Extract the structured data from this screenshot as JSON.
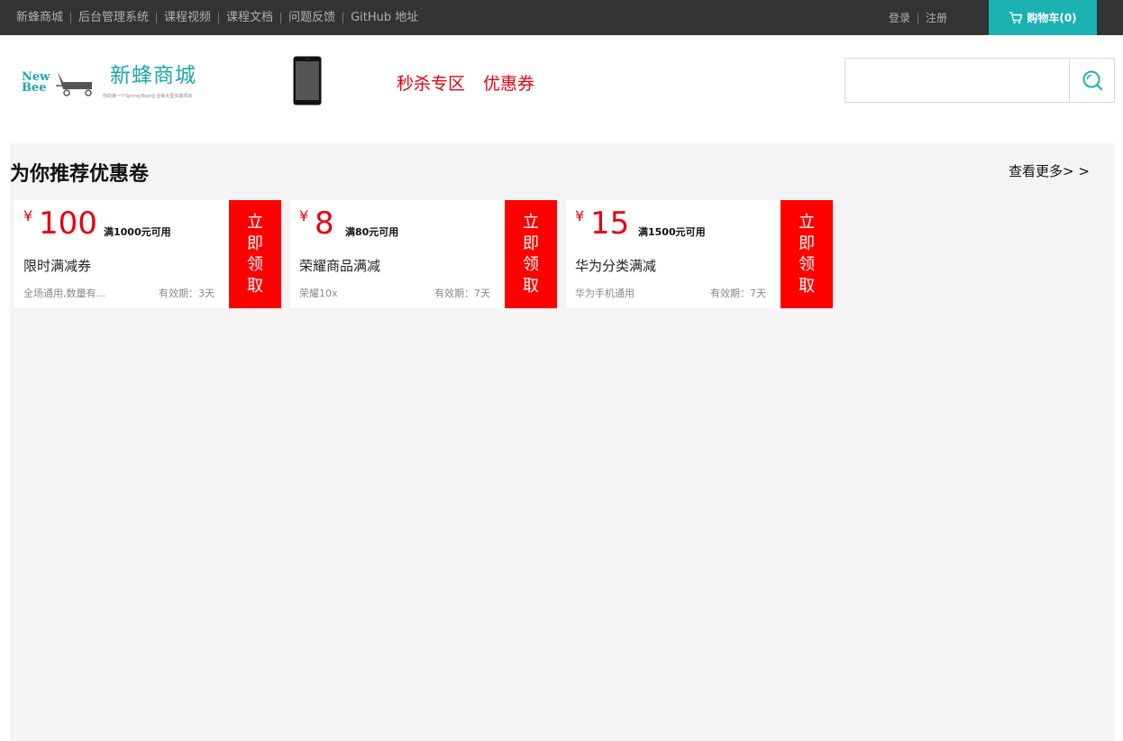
{
  "topnav": {
    "links": [
      "新蜂商城",
      "后台管理系统",
      "课程视频",
      "课程文档",
      "问题反馈",
      "GitHub 地址"
    ]
  },
  "user": {
    "login": "登录",
    "register": "注册"
  },
  "cart": {
    "label": "购物车(0)",
    "icon": "cart-icon"
  },
  "brand": {
    "logo_line1": "New",
    "logo_line2": "Bee",
    "title": "新蜂商城",
    "subtitle": "你的第一个Spring Boot企业级大型实践项目"
  },
  "nav": {
    "seckill": "秒杀专区",
    "coupon": "优惠券"
  },
  "search": {
    "placeholder": "",
    "icon": "search-icon"
  },
  "section": {
    "title": "为你推荐优惠卷",
    "more": "查看更多> >"
  },
  "coupons": [
    {
      "currency": "¥",
      "amount": "100",
      "condition": "满1000元可用",
      "name": "限时满减券",
      "desc": "全场通用,数量有...",
      "validity": "有效期：3天",
      "claim": [
        "立",
        "即",
        "领",
        "取"
      ]
    },
    {
      "currency": "¥",
      "amount": "8",
      "condition": "满80元可用",
      "name": "荣耀商品满减",
      "desc": "荣耀10x",
      "validity": "有效期：7天",
      "claim": [
        "立",
        "即",
        "领",
        "取"
      ]
    },
    {
      "currency": "¥",
      "amount": "15",
      "condition": "满1500元可用",
      "name": "华为分类满减",
      "desc": "华为手机通用",
      "validity": "有效期：7天",
      "claim": [
        "立",
        "即",
        "领",
        "取"
      ]
    }
  ],
  "colors": {
    "topbar": "#333333",
    "accent": "#1bb1b1",
    "red": "#e60012",
    "claim_bg": "#ff0000",
    "main_bg": "#f4f4f4"
  }
}
